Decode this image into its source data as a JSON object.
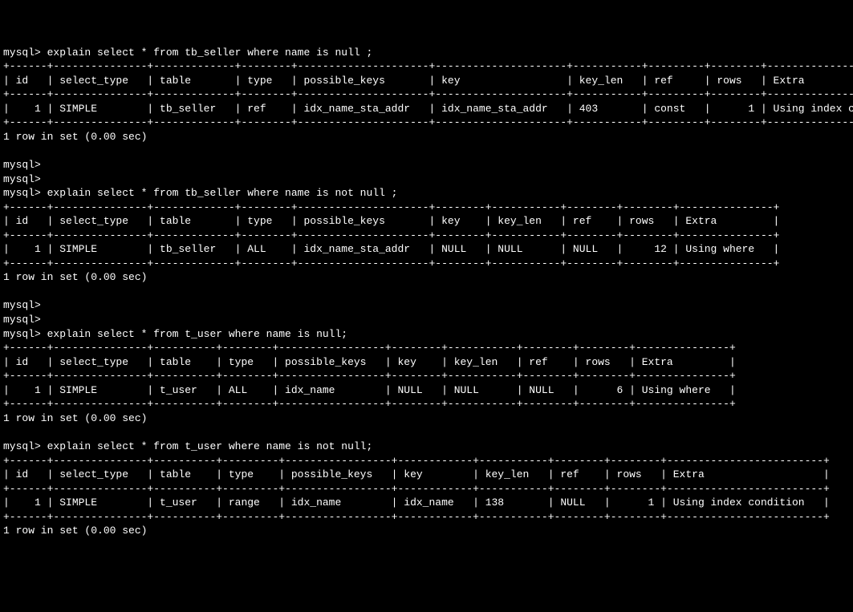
{
  "queries": [
    {
      "prompt": "mysql> ",
      "sql": "explain select * from tb_seller where name is null ;",
      "columns": [
        "id",
        "select_type",
        "table",
        "type",
        "possible_keys",
        "key",
        "key_len",
        "ref",
        "rows",
        "Extra"
      ],
      "widths": [
        4,
        13,
        11,
        6,
        19,
        19,
        9,
        7,
        6,
        23
      ],
      "aligns": [
        "r",
        "l",
        "l",
        "l",
        "l",
        "l",
        "l",
        "l",
        "r",
        "l"
      ],
      "rows": [
        [
          "1",
          "SIMPLE",
          "tb_seller",
          "ref",
          "idx_name_sta_addr",
          "idx_name_sta_addr",
          "403",
          "const",
          "1",
          "Using index condition"
        ]
      ],
      "footer": "1 row in set (0.00 sec)",
      "blank_prompts_after": 2
    },
    {
      "prompt": "mysql> ",
      "sql": "explain select * from tb_seller where name is not null ;",
      "columns": [
        "id",
        "select_type",
        "table",
        "type",
        "possible_keys",
        "key",
        "key_len",
        "ref",
        "rows",
        "Extra"
      ],
      "widths": [
        4,
        13,
        11,
        6,
        19,
        6,
        9,
        6,
        6,
        13
      ],
      "aligns": [
        "r",
        "l",
        "l",
        "l",
        "l",
        "l",
        "l",
        "l",
        "r",
        "l"
      ],
      "rows": [
        [
          "1",
          "SIMPLE",
          "tb_seller",
          "ALL",
          "idx_name_sta_addr",
          "NULL",
          "NULL",
          "NULL",
          "12",
          "Using where"
        ]
      ],
      "footer": "1 row in set (0.00 sec)",
      "blank_prompts_after": 2
    },
    {
      "prompt": "mysql> ",
      "sql": "explain select * from t_user where name is null;",
      "columns": [
        "id",
        "select_type",
        "table",
        "type",
        "possible_keys",
        "key",
        "key_len",
        "ref",
        "rows",
        "Extra"
      ],
      "widths": [
        4,
        13,
        8,
        6,
        15,
        6,
        9,
        6,
        6,
        13
      ],
      "aligns": [
        "r",
        "l",
        "l",
        "l",
        "l",
        "l",
        "l",
        "l",
        "r",
        "l"
      ],
      "rows": [
        [
          "1",
          "SIMPLE",
          "t_user",
          "ALL",
          "idx_name",
          "NULL",
          "NULL",
          "NULL",
          "6",
          "Using where"
        ]
      ],
      "footer": "1 row in set (0.00 sec)",
      "blank_prompts_after": 0
    },
    {
      "prompt": "mysql> ",
      "sql": "explain select * from t_user where name is not null;",
      "columns": [
        "id",
        "select_type",
        "table",
        "type",
        "possible_keys",
        "key",
        "key_len",
        "ref",
        "rows",
        "Extra"
      ],
      "widths": [
        4,
        13,
        8,
        7,
        15,
        10,
        9,
        6,
        6,
        23
      ],
      "aligns": [
        "r",
        "l",
        "l",
        "l",
        "l",
        "l",
        "l",
        "l",
        "r",
        "l"
      ],
      "rows": [
        [
          "1",
          "SIMPLE",
          "t_user",
          "range",
          "idx_name",
          "idx_name",
          "138",
          "NULL",
          "1",
          "Using index condition"
        ]
      ],
      "footer": "1 row in set (0.00 sec)",
      "blank_prompts_after": 0
    }
  ],
  "chart_data": [
    {
      "type": "table",
      "title": "explain select * from tb_seller where name is null",
      "columns": [
        "id",
        "select_type",
        "table",
        "type",
        "possible_keys",
        "key",
        "key_len",
        "ref",
        "rows",
        "Extra"
      ],
      "rows": [
        [
          1,
          "SIMPLE",
          "tb_seller",
          "ref",
          "idx_name_sta_addr",
          "idx_name_sta_addr",
          403,
          "const",
          1,
          "Using index condition"
        ]
      ]
    },
    {
      "type": "table",
      "title": "explain select * from tb_seller where name is not null",
      "columns": [
        "id",
        "select_type",
        "table",
        "type",
        "possible_keys",
        "key",
        "key_len",
        "ref",
        "rows",
        "Extra"
      ],
      "rows": [
        [
          1,
          "SIMPLE",
          "tb_seller",
          "ALL",
          "idx_name_sta_addr",
          null,
          null,
          null,
          12,
          "Using where"
        ]
      ]
    },
    {
      "type": "table",
      "title": "explain select * from t_user where name is null",
      "columns": [
        "id",
        "select_type",
        "table",
        "type",
        "possible_keys",
        "key",
        "key_len",
        "ref",
        "rows",
        "Extra"
      ],
      "rows": [
        [
          1,
          "SIMPLE",
          "t_user",
          "ALL",
          "idx_name",
          null,
          null,
          null,
          6,
          "Using where"
        ]
      ]
    },
    {
      "type": "table",
      "title": "explain select * from t_user where name is not null",
      "columns": [
        "id",
        "select_type",
        "table",
        "type",
        "possible_keys",
        "key",
        "key_len",
        "ref",
        "rows",
        "Extra"
      ],
      "rows": [
        [
          1,
          "SIMPLE",
          "t_user",
          "range",
          "idx_name",
          "idx_name",
          138,
          null,
          1,
          "Using index condition"
        ]
      ]
    }
  ]
}
